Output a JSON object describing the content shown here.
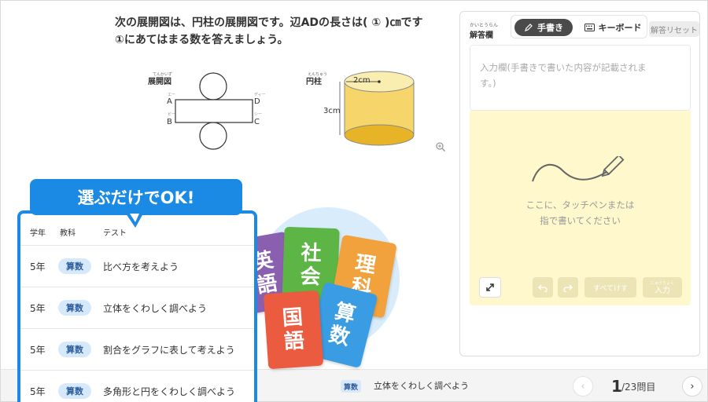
{
  "question": {
    "line1": "次の展開図は、円柱の展開図です。辺ADの長さは( ① )㎝です",
    "line2": "①にあてはまる数を答えましょう。",
    "net_ruby": "てんかいず",
    "net_label": "展開図",
    "cyl_ruby": "えんちゅう",
    "cyl_label": "円柱",
    "pt_a": "A",
    "pt_a_ruby": "エー",
    "pt_b": "B",
    "pt_b_ruby": "ビー",
    "pt_c": "C",
    "pt_c_ruby": "シー",
    "pt_d": "D",
    "pt_d_ruby": "ディー",
    "radius": "2cm",
    "height": "3cm"
  },
  "answer_panel": {
    "title_ruby": "かいとうらん",
    "title": "解答欄",
    "mode_hand": "手書き",
    "mode_keyboard": "キーボード",
    "reset": "解答リセット",
    "input_placeholder_1": "入力欄(手書きで書いた内容が記載されま",
    "input_placeholder_2": "す。)",
    "write_hint_1": "ここに、タッチペンまたは",
    "write_hint_2": "指で書いてください",
    "erase_all": "すべてけす",
    "enter_ruby": "にゅうりょく",
    "enter": "入力"
  },
  "bottom": {
    "subject_badge": "算数",
    "unit_title": "立体をくわしく調べよう",
    "page_current": "1",
    "page_total": "/23問目"
  },
  "callout": "選ぶだけでOK!",
  "list": {
    "headers": [
      "学年",
      "教科",
      "テスト"
    ],
    "rows": [
      {
        "grade": "5年",
        "subject": "算数",
        "unit": "比べ方を考えよう"
      },
      {
        "grade": "5年",
        "subject": "算数",
        "unit": "立体をくわしく調べよう"
      },
      {
        "grade": "5年",
        "subject": "算数",
        "unit": "割合をグラフに表して考えよう"
      },
      {
        "grade": "5年",
        "subject": "算数",
        "unit": "多角形と円をくわしく調べよう"
      }
    ]
  },
  "subject_cards": [
    {
      "line1": "英",
      "line2": "語",
      "color": "#8a5fb0"
    },
    {
      "line1": "社",
      "line2": "会",
      "color": "#5cb545"
    },
    {
      "line1": "理",
      "line2": "科",
      "color": "#f2a23c"
    },
    {
      "line1": "国",
      "line2": "語",
      "color": "#ea5b40"
    },
    {
      "line1": "算",
      "line2": "数",
      "color": "#3a9de3"
    }
  ]
}
